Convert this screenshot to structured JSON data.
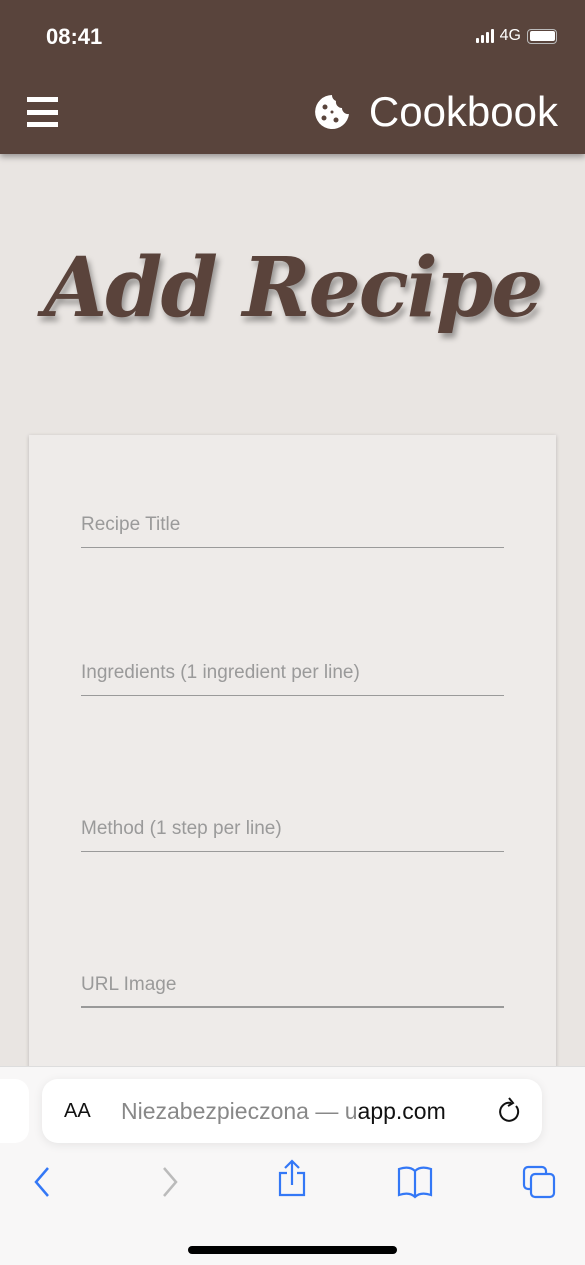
{
  "status_bar": {
    "time": "08:41",
    "network": "4G",
    "battery_level": 1.0
  },
  "header": {
    "menu_icon": "hamburger-icon",
    "logo_icon": "cookie-icon",
    "brand": "Cookbook",
    "background": "#59443c"
  },
  "page": {
    "title": "Add Recipe"
  },
  "form": {
    "fields": [
      {
        "placeholder": "Recipe Title",
        "value": ""
      },
      {
        "placeholder": "Ingredients (1 ingredient per line)",
        "value": ""
      },
      {
        "placeholder": "Method (1 step per line)",
        "value": ""
      },
      {
        "placeholder": "URL Image",
        "value": ""
      }
    ]
  },
  "browser": {
    "text_size": "AA",
    "url_prefix": "Niezabezpieczona — u",
    "url_domain": "app.com",
    "accent": "#3478f6"
  }
}
